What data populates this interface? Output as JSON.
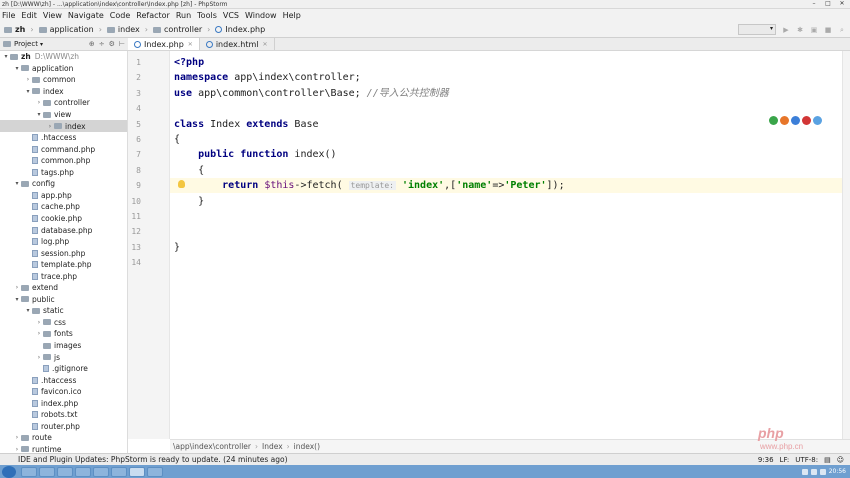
{
  "window": {
    "title": "zh [D:\\WWW\\zh] - ...\\application\\index\\controller\\Index.php [zh] - PhpStorm"
  },
  "menu": [
    "File",
    "Edit",
    "View",
    "Navigate",
    "Code",
    "Refactor",
    "Run",
    "Tools",
    "VCS",
    "Window",
    "Help"
  ],
  "breadcrumb": [
    "zh",
    "application",
    "index",
    "controller",
    "Index.php"
  ],
  "project_panel": {
    "label": "Project"
  },
  "tabs": [
    {
      "label": "Index.php",
      "active": true
    },
    {
      "label": "index.html",
      "active": false
    }
  ],
  "tree": [
    {
      "label": "zh",
      "suffix": "D:\\WWW\\zh",
      "depth": 0,
      "type": "folder",
      "open": true
    },
    {
      "label": "application",
      "depth": 1,
      "type": "folder",
      "open": true
    },
    {
      "label": "common",
      "depth": 2,
      "type": "folder",
      "open": false
    },
    {
      "label": "index",
      "depth": 2,
      "type": "folder",
      "open": true
    },
    {
      "label": "controller",
      "depth": 3,
      "type": "folder",
      "open": false
    },
    {
      "label": "view",
      "depth": 3,
      "type": "folder",
      "open": true
    },
    {
      "label": "index",
      "depth": 4,
      "type": "folder",
      "open": false,
      "selected": true
    },
    {
      "label": ".htaccess",
      "depth": 2,
      "type": "file"
    },
    {
      "label": "command.php",
      "depth": 2,
      "type": "file"
    },
    {
      "label": "common.php",
      "depth": 2,
      "type": "file"
    },
    {
      "label": "tags.php",
      "depth": 2,
      "type": "file"
    },
    {
      "label": "config",
      "depth": 1,
      "type": "folder",
      "open": true
    },
    {
      "label": "app.php",
      "depth": 2,
      "type": "file"
    },
    {
      "label": "cache.php",
      "depth": 2,
      "type": "file"
    },
    {
      "label": "cookie.php",
      "depth": 2,
      "type": "file"
    },
    {
      "label": "database.php",
      "depth": 2,
      "type": "file"
    },
    {
      "label": "log.php",
      "depth": 2,
      "type": "file"
    },
    {
      "label": "session.php",
      "depth": 2,
      "type": "file"
    },
    {
      "label": "template.php",
      "depth": 2,
      "type": "file"
    },
    {
      "label": "trace.php",
      "depth": 2,
      "type": "file"
    },
    {
      "label": "extend",
      "depth": 1,
      "type": "folder",
      "open": false
    },
    {
      "label": "public",
      "depth": 1,
      "type": "folder",
      "open": true
    },
    {
      "label": "static",
      "depth": 2,
      "type": "folder",
      "open": true
    },
    {
      "label": "css",
      "depth": 3,
      "type": "folder",
      "open": false
    },
    {
      "label": "fonts",
      "depth": 3,
      "type": "folder",
      "open": false
    },
    {
      "label": "images",
      "depth": 3,
      "type": "folder",
      "open": null
    },
    {
      "label": "js",
      "depth": 3,
      "type": "folder",
      "open": false
    },
    {
      "label": ".gitignore",
      "depth": 3,
      "type": "file"
    },
    {
      "label": ".htaccess",
      "depth": 2,
      "type": "file"
    },
    {
      "label": "favicon.ico",
      "depth": 2,
      "type": "file"
    },
    {
      "label": "index.php",
      "depth": 2,
      "type": "file"
    },
    {
      "label": "robots.txt",
      "depth": 2,
      "type": "file"
    },
    {
      "label": "router.php",
      "depth": 2,
      "type": "file"
    },
    {
      "label": "route",
      "depth": 1,
      "type": "folder",
      "open": false
    },
    {
      "label": "runtime",
      "depth": 1,
      "type": "folder",
      "open": false
    }
  ],
  "code": {
    "line_numbers": [
      "1",
      "2",
      "3",
      "4",
      "5",
      "6",
      "7",
      "8",
      "9",
      "10",
      "11",
      "12",
      "13",
      "14"
    ],
    "highlight_line": 9,
    "lines": [
      [
        {
          "t": "<?php",
          "c": "kw"
        }
      ],
      [
        {
          "t": "namespace ",
          "c": "kw"
        },
        {
          "t": "app\\index\\controller;",
          "c": ""
        }
      ],
      [
        {
          "t": "use ",
          "c": "kw"
        },
        {
          "t": "app\\common\\controller\\Base; ",
          "c": ""
        },
        {
          "t": "//导入公共控制器",
          "c": "cmt"
        }
      ],
      [],
      [
        {
          "t": "class ",
          "c": "kw"
        },
        {
          "t": "Index ",
          "c": ""
        },
        {
          "t": "extends ",
          "c": "kw"
        },
        {
          "t": "Base",
          "c": ""
        }
      ],
      [
        {
          "t": "{",
          "c": ""
        }
      ],
      [
        {
          "t": "    public function ",
          "c": "kw"
        },
        {
          "t": "index()",
          "c": ""
        }
      ],
      [
        {
          "t": "    {",
          "c": ""
        }
      ],
      [
        {
          "t": "        return ",
          "c": "kw"
        },
        {
          "t": "$this",
          "c": "var"
        },
        {
          "t": "->fetch( ",
          "c": ""
        },
        {
          "t": "template:",
          "c": "hint"
        },
        {
          "t": " ",
          "c": ""
        },
        {
          "t": "'index'",
          "c": "str"
        },
        {
          "t": ",[",
          "c": ""
        },
        {
          "t": "'name'",
          "c": "str"
        },
        {
          "t": "=>",
          "c": ""
        },
        {
          "t": "'Peter'",
          "c": "str"
        },
        {
          "t": "]);",
          "c": ""
        }
      ],
      [
        {
          "t": "    }",
          "c": ""
        }
      ],
      [],
      [],
      [
        {
          "t": "}",
          "c": ""
        }
      ],
      []
    ]
  },
  "editor_breadcrumb": [
    "\\app\\index\\controller",
    "Index",
    "index()"
  ],
  "status": {
    "message": "IDE and Plugin Updates: PhpStorm is ready to update. (24 minutes ago)",
    "position": "9:36",
    "line_sep": "LF:",
    "encoding": "UTF-8:"
  },
  "tray": {
    "time": "20:56"
  },
  "watermark": {
    "logo": "php",
    "site": "www.php.cn"
  },
  "colors": {
    "keyword": "#000080",
    "string": "#008000",
    "comment": "#808080",
    "variable": "#660e7a",
    "highlight": "#fffae3"
  }
}
